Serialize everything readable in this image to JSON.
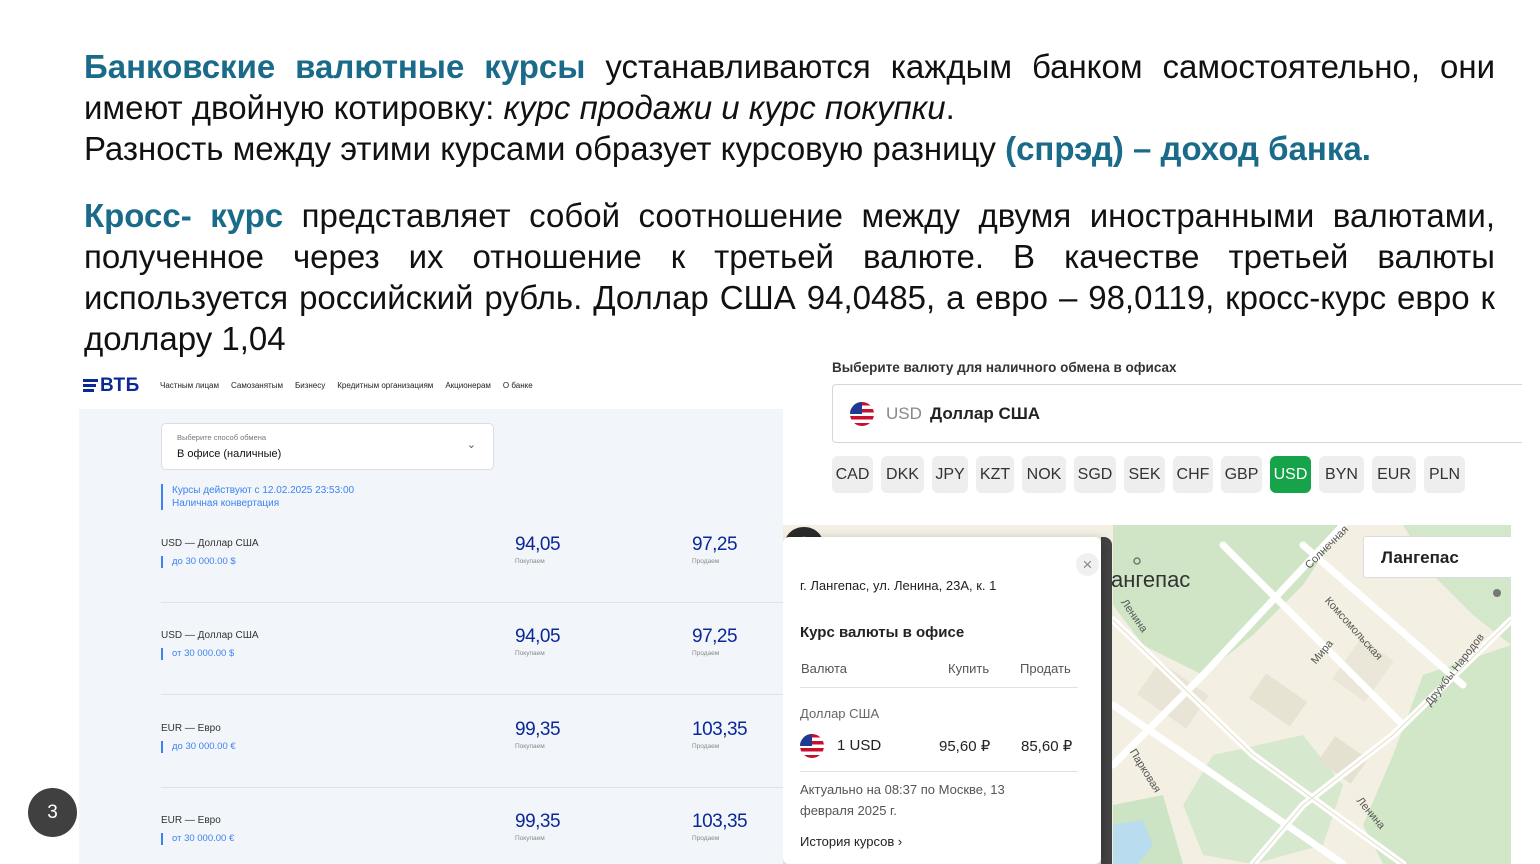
{
  "slide": {
    "p1_bold": "Банковские валютные курсы",
    "p1_rest": " устанавливаются каждым банком самостоятельно, они имеют двойную котировку: ",
    "p1_italic": "курс продажи и курс покупки",
    "p1_end": ".",
    "p2_text": "Разность между этими курсами образует курсовую разницу ",
    "p2_bold": "(спрэд) – доход банка.",
    "p3_bold": "Кросс- курс",
    "p3_rest": " представляет собой соотношение между двумя иностранными валютами, полученное через их отношение к третьей валюте. В качестве третьей валюты используется российский рубль. Доллар США 94,0485, а евро – 98,0119, кросс-курс евро к доллару 1,04",
    "page_number": "3"
  },
  "vtb": {
    "logo": "ВТБ",
    "nav": [
      "Частным лицам",
      "Самозанятым",
      "Бизнесу",
      "Кредитным организациям",
      "Акционерам",
      "О банке"
    ],
    "exchange_method_label": "Выберите способ обмена",
    "exchange_method_value": "В офисе (наличные)",
    "note_line1": "Курсы действуют с 12.02.2025 23:53:00",
    "note_line2": "Наличная конвертация",
    "buy_caption": "Покупаем",
    "sell_caption": "Продаем",
    "rows": [
      {
        "name": "USD — Доллар США",
        "limit": "до 30 000.00 $",
        "buy": "94,05",
        "sell": "97,25"
      },
      {
        "name": "USD — Доллар США",
        "limit": "от 30 000.00 $",
        "buy": "94,05",
        "sell": "97,25"
      },
      {
        "name": "EUR — Евро",
        "limit": "до 30 000.00 €",
        "buy": "99,35",
        "sell": "103,35"
      },
      {
        "name": "EUR — Евро",
        "limit": "от 30 000.00 €",
        "buy": "99,35",
        "sell": "103,35"
      }
    ]
  },
  "currency_picker": {
    "title": "Выберите валюту для наличного обмена в офисах",
    "selected_code": "USD",
    "selected_name": "Доллар США",
    "chips": [
      "CAD",
      "DKK",
      "JPY",
      "KZT",
      "NOK",
      "SGD",
      "SEK",
      "CHF",
      "GBP",
      "USD",
      "BYN",
      "EUR",
      "PLN"
    ],
    "active_chip": "USD",
    "active_color": "#17a349"
  },
  "map": {
    "search_value": "Лангепас",
    "town_label": "ангепас",
    "streets": [
      "Солнечная",
      "Ленина",
      "Комсомольская",
      "Мира",
      "Дружбы Народов",
      "Парковая",
      "Ленина"
    ]
  },
  "office_popup": {
    "address": "г. Лангепас, ул. Ленина, 23А, к. 1",
    "title": "Курс валюты в офисе",
    "col_currency": "Валюта",
    "col_buy": "Купить",
    "col_sell": "Продать",
    "currency_name": "Доллар США",
    "amount": "1 USD",
    "buy": "95,60 ₽",
    "sell": "85,60 ₽",
    "updated": "Актуально на 08:37 по Москве, 13 февраля 2025 г.",
    "history_link": "История курсов ›"
  },
  "colors": {
    "highlight": "#1a6a8a",
    "vtb_blue": "#0a2896",
    "vtb_accent": "#3c83f0"
  }
}
